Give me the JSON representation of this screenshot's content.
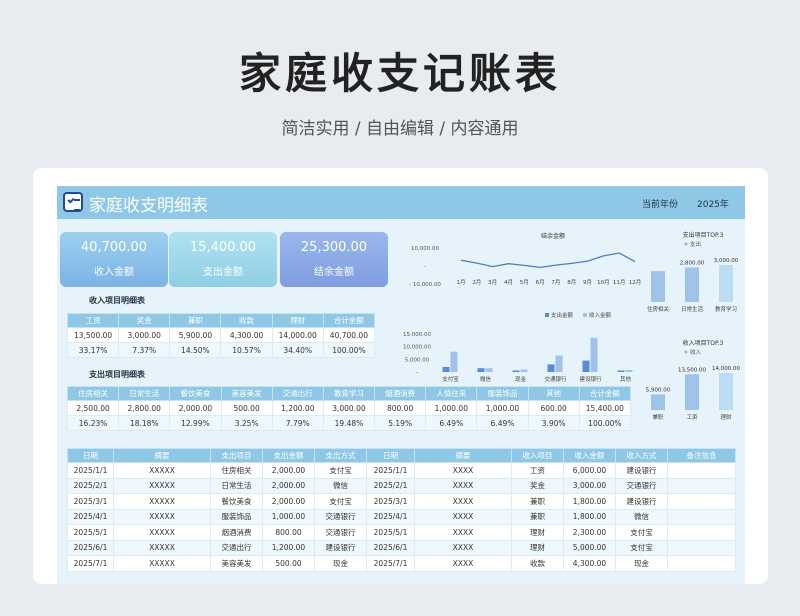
{
  "page": {
    "title": "家庭收支记账表",
    "subtitle": "简洁实用 / 自由编辑 / 内容通用"
  },
  "sheet": {
    "title": "家庭收支明细表",
    "year_label": "当前年份",
    "year_value": "2025年"
  },
  "kpi": {
    "income": {
      "value": "40,700.00",
      "label": "收入金额"
    },
    "expense": {
      "value": "15,400.00",
      "label": "支出金额"
    },
    "balance": {
      "value": "25,300.00",
      "label": "结余金额"
    }
  },
  "income_summary": {
    "title": "收入项目明细表",
    "headers": [
      "工资",
      "奖金",
      "兼职",
      "收款",
      "理财",
      "合计金额"
    ],
    "amounts": [
      "13,500.00",
      "3,000.00",
      "5,900.00",
      "4,300.00",
      "14,000.00",
      "40,700.00"
    ],
    "ratios": [
      "33.17%",
      "7.37%",
      "14.50%",
      "10.57%",
      "34.40%",
      "100.00%"
    ]
  },
  "expense_summary": {
    "title": "支出项目明细表",
    "headers": [
      "住房相关",
      "日常生活",
      "餐饮美食",
      "美容美发",
      "交通出行",
      "教育学习",
      "烟酒消费",
      "人情往来",
      "服装饰品",
      "其他",
      "合计金额"
    ],
    "amounts": [
      "2,500.00",
      "2,800.00",
      "2,000.00",
      "500.00",
      "1,200.00",
      "3,000.00",
      "800.00",
      "1,000.00",
      "1,000.00",
      "600.00",
      "15,400.00"
    ],
    "ratios": [
      "16.23%",
      "18.18%",
      "12.99%",
      "3.25%",
      "7.79%",
      "19.48%",
      "5.19%",
      "6.49%",
      "6.49%",
      "3.90%",
      "100.00%"
    ]
  },
  "detail": {
    "headers": [
      "日期",
      "摘要",
      "支出项目",
      "支出金额",
      "支出方式",
      "日期",
      "摘要",
      "收入项目",
      "收入金额",
      "收入方式",
      "备注信息"
    ],
    "rows": [
      [
        "2025/1/1",
        "XXXXX",
        "住房相关",
        "2,000.00",
        "支付宝",
        "2025/1/1",
        "XXXX",
        "工资",
        "6,000.00",
        "建设银行",
        ""
      ],
      [
        "2025/2/1",
        "XXXXX",
        "日常生活",
        "2,000.00",
        "微信",
        "2025/2/1",
        "XXXX",
        "奖金",
        "3,000.00",
        "交通银行",
        ""
      ],
      [
        "2025/3/1",
        "XXXXX",
        "餐饮美食",
        "2,000.00",
        "支付宝",
        "2025/3/1",
        "XXXX",
        "兼职",
        "1,800.00",
        "建设银行",
        ""
      ],
      [
        "2025/4/1",
        "XXXXX",
        "服装饰品",
        "1,000.00",
        "交通银行",
        "2025/4/1",
        "XXXX",
        "兼职",
        "1,800.00",
        "微信",
        ""
      ],
      [
        "2025/5/1",
        "XXXXX",
        "烟酒消费",
        "800.00",
        "交通银行",
        "2025/5/1",
        "XXXX",
        "理财",
        "2,300.00",
        "支付宝",
        ""
      ],
      [
        "2025/6/1",
        "XXXXX",
        "交通出行",
        "1,200.00",
        "建设银行",
        "2025/6/1",
        "XXXX",
        "理财",
        "5,000.00",
        "支付宝",
        ""
      ],
      [
        "2025/7/1",
        "XXXXX",
        "美容美发",
        "500.00",
        "现金",
        "2025/7/1",
        "XXXX",
        "收款",
        "4,300.00",
        "现金",
        ""
      ]
    ]
  },
  "colors": {
    "banner": "#8ec8e6",
    "line": "#4f7fc0",
    "bar_dark": "#5b8bd6",
    "bar_light": "#9fc3ea",
    "bar_pale": "#bcdcf3"
  },
  "chart_data": [
    {
      "type": "line",
      "title": "结余金额",
      "categories": [
        "1月",
        "2月",
        "3月",
        "4月",
        "5月",
        "6月",
        "7月",
        "8月",
        "9月",
        "10月",
        "11月",
        "12月"
      ],
      "values": [
        2000,
        1000,
        -200,
        800,
        200,
        -500,
        300,
        900,
        1700,
        3500,
        4500,
        1500
      ],
      "y_ticks": [
        "10,000.00",
        "-",
        "- 10,000.00"
      ],
      "ylim": [
        -10000,
        10000
      ]
    },
    {
      "type": "bar",
      "categories": [
        "支付宝",
        "微信",
        "现金",
        "交通银行",
        "建设银行",
        "其他"
      ],
      "series": [
        {
          "name": "支出金额",
          "values": [
            2000,
            1500,
            600,
            3000,
            4500,
            600
          ]
        },
        {
          "name": "收入金额",
          "values": [
            8000,
            1500,
            1000,
            6500,
            13500,
            800
          ]
        }
      ],
      "y_ticks": [
        "15,000.00",
        "10,000.00",
        "5,000.00",
        "-"
      ],
      "ylim": [
        0,
        15000
      ]
    },
    {
      "type": "bar",
      "title": "支出项目TOP.3",
      "legend": "支出",
      "categories": [
        "住房相关",
        "日常生活",
        "教育学习"
      ],
      "values": [
        2500,
        2800,
        3000
      ],
      "labels": [
        "2,800.00",
        "3,000.00"
      ],
      "ylim": [
        0,
        3000
      ]
    },
    {
      "type": "bar",
      "title": "收入项目TOP.3",
      "legend": "收入",
      "categories": [
        "兼职",
        "工资",
        "理财"
      ],
      "values": [
        5900,
        13500,
        14000
      ],
      "labels": [
        "5,900.00",
        "13,500.00",
        "14,000.00"
      ],
      "ylim": [
        0,
        14000
      ]
    }
  ]
}
